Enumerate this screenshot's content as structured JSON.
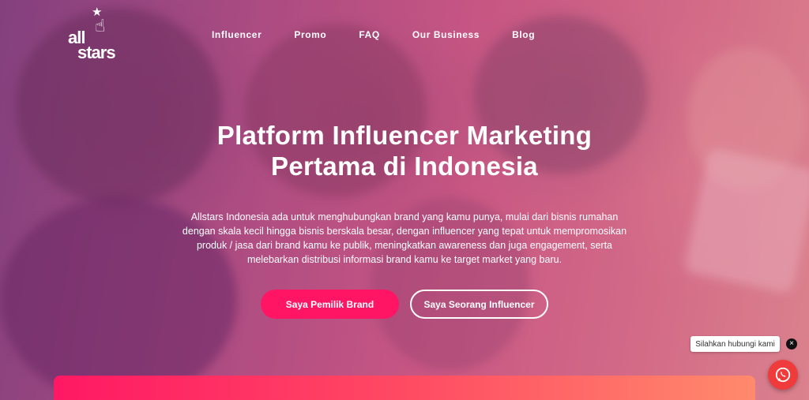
{
  "logo": {
    "line1": "all",
    "line2": "stars",
    "star_glyph": "★",
    "hand_glyph": "☝"
  },
  "nav": {
    "items": [
      {
        "label": "Influencer"
      },
      {
        "label": "Promo"
      },
      {
        "label": "FAQ"
      },
      {
        "label": "Our Business"
      },
      {
        "label": "Blog"
      }
    ]
  },
  "hero": {
    "title_line1": "Platform Influencer Marketing",
    "title_line2": "Pertama di Indonesia",
    "description": "Allstars Indonesia ada untuk menghubungkan brand yang kamu punya, mulai dari bisnis rumahan dengan skala kecil hingga bisnis berskala besar, dengan influencer yang tepat untuk mempromosikan produk / jasa dari brand kamu ke publik, meningkatkan awareness dan juga engagement, serta melebarkan distribusi informasi brand kamu ke target market yang baru.",
    "primary_button": "Saya Pemilik Brand",
    "secondary_button": "Saya Seorang Influencer"
  },
  "chat": {
    "tooltip": "Silahkan hubungi kami",
    "close_glyph": "×",
    "icon": "whatsapp-icon"
  },
  "colors": {
    "primary": "#ff1563",
    "chat": "#ef3b3b",
    "bar_start": "#ff1864",
    "bar_end": "#ff8a6c"
  }
}
